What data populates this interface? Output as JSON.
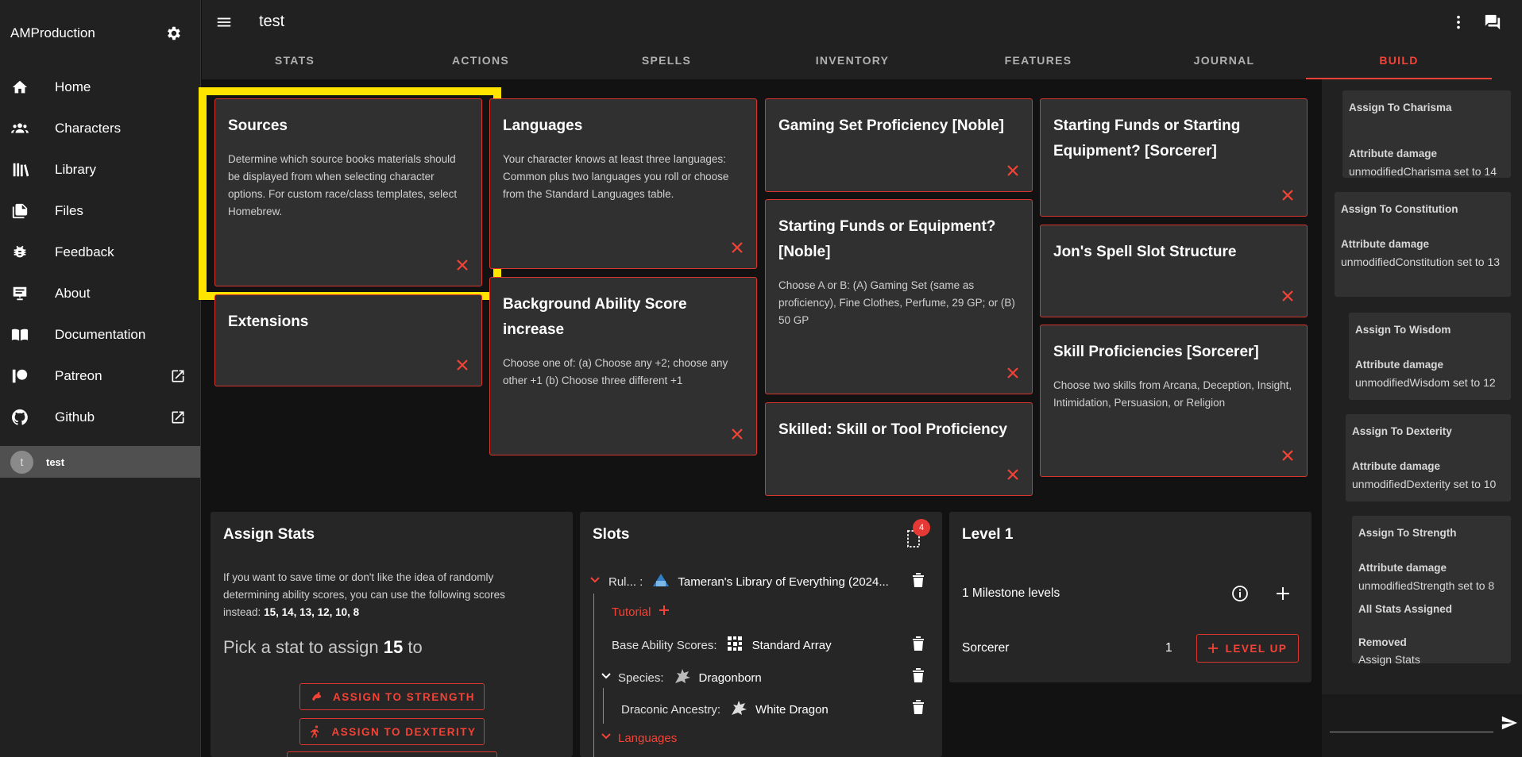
{
  "sidebar": {
    "title": "AMProduction",
    "items": [
      {
        "label": "Home",
        "icon": "home-icon"
      },
      {
        "label": "Characters",
        "icon": "people-icon"
      },
      {
        "label": "Library",
        "icon": "library-icon"
      },
      {
        "label": "Files",
        "icon": "files-icon"
      },
      {
        "label": "Feedback",
        "icon": "bug-icon"
      },
      {
        "label": "About",
        "icon": "about-icon"
      },
      {
        "label": "Documentation",
        "icon": "book-icon"
      },
      {
        "label": "Patreon",
        "icon": "patreon-icon"
      },
      {
        "label": "Github",
        "icon": "github-icon"
      }
    ],
    "character": {
      "avatar_letter": "t",
      "name": "test"
    }
  },
  "topbar": {
    "title": "test",
    "tabs": [
      "STATS",
      "ACTIONS",
      "SPELLS",
      "INVENTORY",
      "FEATURES",
      "JOURNAL",
      "BUILD"
    ],
    "active_tab": "BUILD"
  },
  "cards": {
    "sources": {
      "title": "Sources",
      "desc": "Determine which source books materials should be displayed from when selecting character options. For custom race/class templates, select Homebrew."
    },
    "extensions": {
      "title": "Extensions"
    },
    "languages": {
      "title": "Languages",
      "desc": "Your character knows at least three languages: Common plus two languages you roll or choose from the Standard Languages table."
    },
    "background_asi": {
      "title": "Background Ability Score increase",
      "desc": "Choose one of: (a) Choose any +2; choose any other +1 (b) Choose three different +1"
    },
    "gaming_set": {
      "title": "Gaming Set Proficiency [Noble]"
    },
    "starting_funds_noble": {
      "title": "Starting Funds or Equipment? [Noble]",
      "desc": "Choose A or B: (A) Gaming Set (same as proficiency), Fine Clothes, Perfume, 29 GP; or (B) 50 GP"
    },
    "skilled": {
      "title": "Skilled: Skill or Tool Proficiency"
    },
    "starting_funds_sorc": {
      "title": "Starting Funds or Starting Equipment? [Sorcerer]"
    },
    "spell_slot": {
      "title": "Jon's Spell Slot Structure"
    },
    "skill_prof": {
      "title": "Skill Proficiencies [Sorcerer]",
      "desc": "Choose two skills from Arcana, Deception, Insight, Intimidation, Persuasion, or Religion"
    }
  },
  "assign_stats": {
    "title": "Assign Stats",
    "desc": "If you want to save time or don't like the idea of randomly determining ability scores, you can use the following scores instead:",
    "scores": "15, 14, 13, 12, 10, 8",
    "pick_prefix": "Pick a stat to assign",
    "pick_value": "15",
    "pick_suffix": "to",
    "btn_strength": "ASSIGN TO STRENGTH",
    "btn_dexterity": "ASSIGN TO DEXTERITY"
  },
  "slots": {
    "title": "Slots",
    "badge": "4",
    "rules_label": "Rul... :",
    "rules_value": "Tameran's Library of Everything (2024...",
    "tutorial": "Tutorial",
    "base_label": "Base Ability Scores:",
    "base_value": "Standard Array",
    "species_label": "Species:",
    "species_value": "Dragonborn",
    "ancestry_label": "Draconic Ancestry:",
    "ancestry_value": "White Dragon",
    "languages": "Languages"
  },
  "level": {
    "title": "Level 1",
    "milestone": "1 Milestone levels",
    "class_name": "Sorcerer",
    "class_level": "1",
    "level_up": "LEVEL UP"
  },
  "log": [
    {
      "title": "Assign To Charisma",
      "sub": "Attribute damage",
      "value": "unmodifiedCharisma set to 14"
    },
    {
      "title": "Assign To Constitution",
      "sub": "Attribute damage",
      "value": "unmodifiedConstitution set to 13"
    },
    {
      "title": "Assign To Wisdom",
      "sub": "Attribute damage",
      "value": "unmodifiedWisdom set to 12"
    },
    {
      "title": "Assign To Dexterity",
      "sub": "Attribute damage",
      "value": "unmodifiedDexterity set to 10"
    },
    {
      "title": "Assign To Strength",
      "sub": "Attribute damage",
      "value": "unmodifiedStrength set to 8",
      "extra": "All Stats Assigned",
      "removed_label": "Removed",
      "removed_value": "Assign Stats"
    }
  ],
  "colors": {
    "accent": "#f44336",
    "highlight": "#ffe400",
    "card_bg": "#303030",
    "sidebar_bg": "#212121"
  }
}
